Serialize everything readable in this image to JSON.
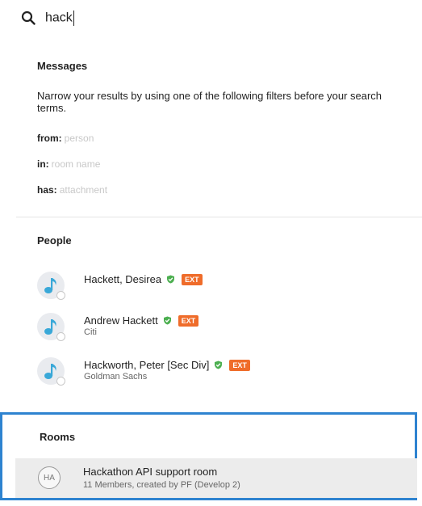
{
  "search": {
    "value": "hack"
  },
  "messages": {
    "title": "Messages",
    "description": "Narrow your results by using one of the following filters before your search terms.",
    "filters": [
      {
        "key": "from:",
        "hint": "person"
      },
      {
        "key": "in:",
        "hint": "room name"
      },
      {
        "key": "has:",
        "hint": "attachment"
      }
    ]
  },
  "people": {
    "title": "People",
    "items": [
      {
        "name": "Hackett, Desirea",
        "subtitle": "",
        "badge": "EXT"
      },
      {
        "name": "Andrew Hackett",
        "subtitle": "Citi",
        "badge": "EXT"
      },
      {
        "name": "Hackworth, Peter [Sec Div]",
        "subtitle": "Goldman Sachs",
        "badge": "EXT"
      }
    ]
  },
  "rooms": {
    "title": "Rooms",
    "items": [
      {
        "initials": "HA",
        "name": "Hackathon API support room",
        "subtitle": "11 Members, created by PF (Develop 2)"
      }
    ]
  },
  "colors": {
    "accent": "#2e83d0",
    "ext_badge": "#ef6c2a",
    "verified": "#4caf50",
    "avatar_note": "#39a8d8"
  }
}
